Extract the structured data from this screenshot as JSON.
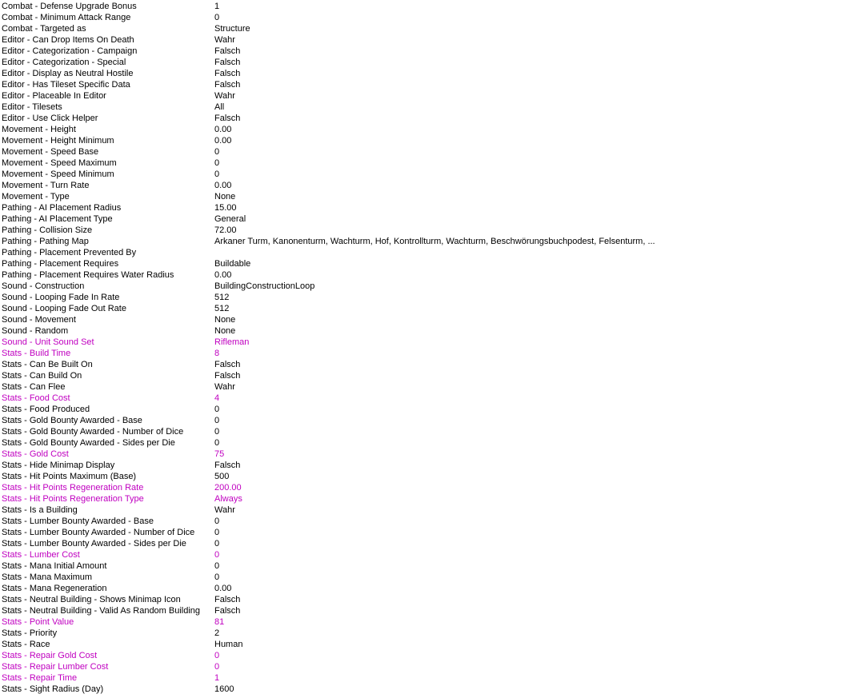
{
  "colors": {
    "default_text": "#000000",
    "modified_text": "#c000c0",
    "background": "#ffffff"
  },
  "properties": [
    {
      "name": "Combat - Defense Upgrade Bonus",
      "value": "1",
      "modified": false
    },
    {
      "name": "Combat - Minimum Attack Range",
      "value": "0",
      "modified": false
    },
    {
      "name": "Combat - Targeted as",
      "value": "Structure",
      "modified": false
    },
    {
      "name": "Editor - Can Drop Items On Death",
      "value": "Wahr",
      "modified": false
    },
    {
      "name": "Editor - Categorization - Campaign",
      "value": "Falsch",
      "modified": false
    },
    {
      "name": "Editor - Categorization - Special",
      "value": "Falsch",
      "modified": false
    },
    {
      "name": "Editor - Display as Neutral Hostile",
      "value": "Falsch",
      "modified": false
    },
    {
      "name": "Editor - Has Tileset Specific Data",
      "value": "Falsch",
      "modified": false
    },
    {
      "name": "Editor - Placeable In Editor",
      "value": "Wahr",
      "modified": false
    },
    {
      "name": "Editor - Tilesets",
      "value": "All",
      "modified": false
    },
    {
      "name": "Editor - Use Click Helper",
      "value": "Falsch",
      "modified": false
    },
    {
      "name": "Movement - Height",
      "value": "0.00",
      "modified": false
    },
    {
      "name": "Movement - Height Minimum",
      "value": "0.00",
      "modified": false
    },
    {
      "name": "Movement - Speed Base",
      "value": "0",
      "modified": false
    },
    {
      "name": "Movement - Speed Maximum",
      "value": "0",
      "modified": false
    },
    {
      "name": "Movement - Speed Minimum",
      "value": "0",
      "modified": false
    },
    {
      "name": "Movement - Turn Rate",
      "value": "0.00",
      "modified": false
    },
    {
      "name": "Movement - Type",
      "value": "None",
      "modified": false
    },
    {
      "name": "Pathing - AI Placement Radius",
      "value": "15.00",
      "modified": false
    },
    {
      "name": "Pathing - AI Placement Type",
      "value": "General",
      "modified": false
    },
    {
      "name": "Pathing - Collision Size",
      "value": "72.00",
      "modified": false
    },
    {
      "name": "Pathing - Pathing Map",
      "value": "Arkaner Turm, Kanonenturm, Wachturm, Hof, Kontrollturm, Wachturm, Beschwörungsbuchpodest, Felsenturm, ...",
      "modified": false
    },
    {
      "name": "Pathing - Placement Prevented By",
      "value": "",
      "modified": false
    },
    {
      "name": "Pathing - Placement Requires",
      "value": "Buildable",
      "modified": false
    },
    {
      "name": "Pathing - Placement Requires Water Radius",
      "value": "0.00",
      "modified": false
    },
    {
      "name": "Sound - Construction",
      "value": "BuildingConstructionLoop",
      "modified": false
    },
    {
      "name": "Sound - Looping Fade In Rate",
      "value": "512",
      "modified": false
    },
    {
      "name": "Sound - Looping Fade Out Rate",
      "value": "512",
      "modified": false
    },
    {
      "name": "Sound - Movement",
      "value": "None",
      "modified": false
    },
    {
      "name": "Sound - Random",
      "value": "None",
      "modified": false
    },
    {
      "name": "Sound - Unit Sound Set",
      "value": "Rifleman",
      "modified": true
    },
    {
      "name": "Stats - Build Time",
      "value": "8",
      "modified": true
    },
    {
      "name": "Stats - Can Be Built On",
      "value": "Falsch",
      "modified": false
    },
    {
      "name": "Stats - Can Build On",
      "value": "Falsch",
      "modified": false
    },
    {
      "name": "Stats - Can Flee",
      "value": "Wahr",
      "modified": false
    },
    {
      "name": "Stats - Food Cost",
      "value": "4",
      "modified": true
    },
    {
      "name": "Stats - Food Produced",
      "value": "0",
      "modified": false
    },
    {
      "name": "Stats - Gold Bounty Awarded - Base",
      "value": "0",
      "modified": false
    },
    {
      "name": "Stats - Gold Bounty Awarded - Number of Dice",
      "value": "0",
      "modified": false
    },
    {
      "name": "Stats - Gold Bounty Awarded - Sides per Die",
      "value": "0",
      "modified": false
    },
    {
      "name": "Stats - Gold Cost",
      "value": "75",
      "modified": true
    },
    {
      "name": "Stats - Hide Minimap Display",
      "value": "Falsch",
      "modified": false
    },
    {
      "name": "Stats - Hit Points Maximum (Base)",
      "value": "500",
      "modified": false
    },
    {
      "name": "Stats - Hit Points Regeneration Rate",
      "value": "200.00",
      "modified": true
    },
    {
      "name": "Stats - Hit Points Regeneration Type",
      "value": "Always",
      "modified": true
    },
    {
      "name": "Stats - Is a Building",
      "value": "Wahr",
      "modified": false
    },
    {
      "name": "Stats - Lumber Bounty Awarded - Base",
      "value": "0",
      "modified": false
    },
    {
      "name": "Stats - Lumber Bounty Awarded - Number of Dice",
      "value": "0",
      "modified": false
    },
    {
      "name": "Stats - Lumber Bounty Awarded - Sides per Die",
      "value": "0",
      "modified": false
    },
    {
      "name": "Stats - Lumber Cost",
      "value": "0",
      "modified": true
    },
    {
      "name": "Stats - Mana Initial Amount",
      "value": "0",
      "modified": false
    },
    {
      "name": "Stats - Mana Maximum",
      "value": "0",
      "modified": false
    },
    {
      "name": "Stats - Mana Regeneration",
      "value": "0.00",
      "modified": false
    },
    {
      "name": "Stats - Neutral Building - Shows Minimap Icon",
      "value": "Falsch",
      "modified": false
    },
    {
      "name": "Stats - Neutral Building - Valid As Random Building",
      "value": "Falsch",
      "modified": false
    },
    {
      "name": "Stats - Point Value",
      "value": "81",
      "modified": true
    },
    {
      "name": "Stats - Priority",
      "value": "2",
      "modified": false
    },
    {
      "name": "Stats - Race",
      "value": "Human",
      "modified": false
    },
    {
      "name": "Stats - Repair Gold Cost",
      "value": "0",
      "modified": true
    },
    {
      "name": "Stats - Repair Lumber Cost",
      "value": "0",
      "modified": true
    },
    {
      "name": "Stats - Repair Time",
      "value": "1",
      "modified": true
    },
    {
      "name": "Stats - Sight Radius (Day)",
      "value": "1600",
      "modified": false
    }
  ]
}
